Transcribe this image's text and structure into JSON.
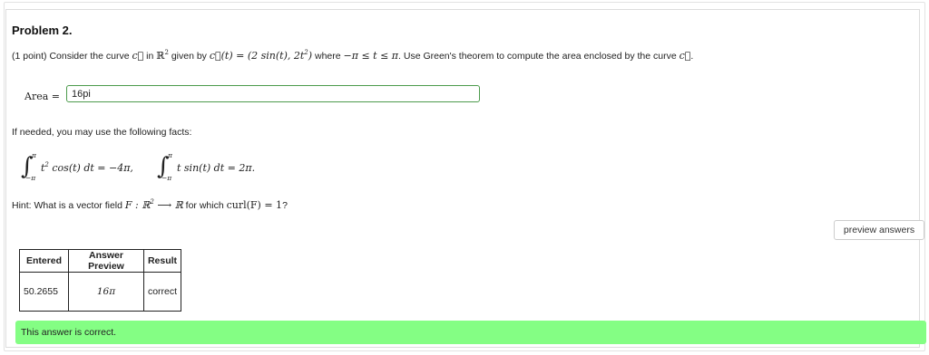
{
  "problem": {
    "title": "Problem 2.",
    "points": "(1 point)",
    "s1": " Consider the curve ",
    "curve_c": "c⃗",
    "s2": " in ",
    "R": "ℝ",
    "two": "2",
    "s3": " given by ",
    "param": "c⃗(t) = (2 sin(t), 2t",
    "param_sup": "2",
    "param_end": ")",
    "s4": " where ",
    "range": "−π ≤ t ≤ π",
    "s5": ". Use Green's theorem to compute the area enclosed by the curve ",
    "s6": "."
  },
  "answer": {
    "label": "Area =",
    "value": "16pi"
  },
  "facts": {
    "intro": "If needed, you may use the following facts:",
    "upper": "π",
    "lower": "−π",
    "int1_body_a": "t",
    "int1_body_sup": "2",
    "int1_body_b": " cos(t) dt = −4π,",
    "int2_body": "t sin(t) dt = 2π."
  },
  "hint": {
    "a": "Hint: What is a vector field ",
    "F": "F : ℝ",
    "sup": "2",
    "arrow": " ⟶ ℝ",
    "b": " for which ",
    "curl": "curl(F) = 1",
    "c": "?"
  },
  "buttons": {
    "preview": "preview answers"
  },
  "results": {
    "headers": [
      "Entered",
      "Answer Preview",
      "Result"
    ],
    "entered": "50.2655",
    "preview": "16π",
    "result": "correct"
  },
  "status": {
    "message": "This answer is correct."
  },
  "colors": {
    "success_bg": "#84fe84",
    "input_border": "#4c9b4c"
  }
}
